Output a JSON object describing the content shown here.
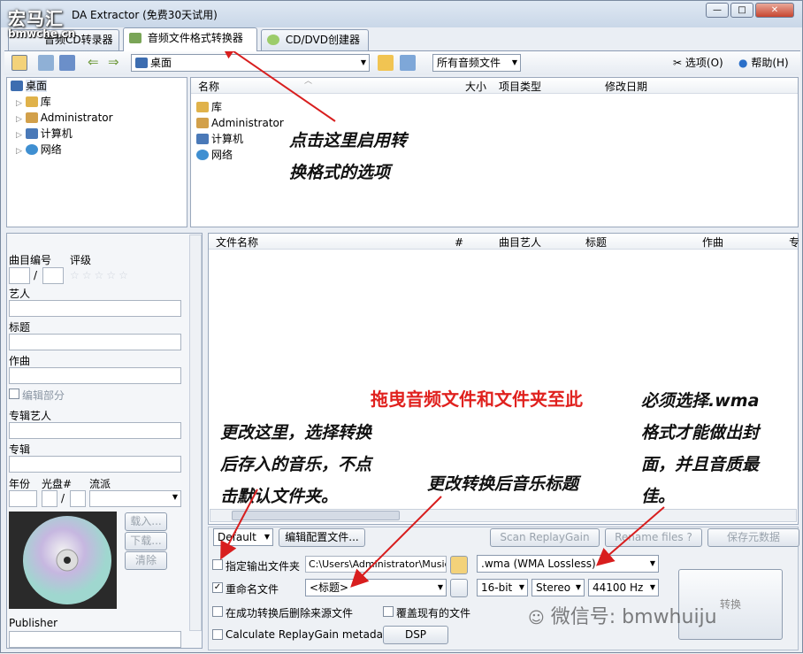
{
  "app": {
    "title": "DA Extractor (免费30天试用)",
    "brand": "宏马汇",
    "brand_sub": "bmwche.cn"
  },
  "window_controls": {
    "minimize": "—",
    "maximize": "□",
    "close": "✕"
  },
  "tabs": [
    {
      "label": "音频CD转录器"
    },
    {
      "label": "音频文件格式转换器"
    },
    {
      "label": "CD/DVD创建器"
    }
  ],
  "toolbar": {
    "location": "桌面",
    "filter": "所有音频文件",
    "options": "选项(O)",
    "help": "帮助(H)"
  },
  "tree": {
    "root": "桌面",
    "items": [
      "库",
      "Administrator",
      "计算机",
      "网络"
    ]
  },
  "browser": {
    "columns": [
      "名称",
      "大小",
      "项目类型",
      "修改日期"
    ],
    "items": [
      "库",
      "Administrator",
      "计算机",
      "网络"
    ]
  },
  "filelist": {
    "columns": [
      "文件名称",
      "#",
      "曲目艺人",
      "标题",
      "作曲",
      "专"
    ],
    "drop_hint": "拖曳音频文件和文件夹至此"
  },
  "meta": {
    "track_no": "曲目编号",
    "rating": "评级",
    "slash": "/",
    "artist": "艺人",
    "title": "标题",
    "composer": "作曲",
    "edit_part": "编辑部分",
    "album_artist": "专辑艺人",
    "album": "专辑",
    "year": "年份",
    "disc": "光盘#",
    "genre": "流派",
    "load": "载入...",
    "download": "下载...",
    "clear": "清除",
    "publisher": "Publisher"
  },
  "bottom": {
    "profile": "Default",
    "edit_profile": "编辑配置文件...",
    "scan_rg": "Scan ReplayGain",
    "rename": "Rename files ?",
    "save_meta": "保存元数据",
    "output_folder_label": "指定输出文件夹",
    "output_folder_value": "C:\\Users\\Administrator\\Music",
    "rename_label": "重命名文件",
    "rename_value": "<标题>",
    "delete_source": "在成功转换后删除来源文件",
    "overwrite": "覆盖现有的文件",
    "calc_rg": "Calculate ReplayGain metadata",
    "dsp": "DSP",
    "format": ".wma (WMA Lossless)",
    "bits": "16-bit",
    "channels": "Stereo",
    "rate": "44100 Hz",
    "convert": "转换"
  },
  "annotations": {
    "a1": "点击这里启用转换格式的选项",
    "a1_l1": "点击这里启用转",
    "a1_l2": "换格式的选项",
    "a2_l1": "更改这里，选择转换",
    "a2_l2": "后存入的音乐，不点",
    "a2_l3": "击默认文件夹。",
    "a3": "更改转换后音乐标题",
    "a4_l1": "必须选择.wma",
    "a4_l2": "格式才能做出封",
    "a4_l3": "面，并且音质最",
    "a4_l4": "佳。"
  },
  "watermark": "微信号: bmwhuiju",
  "colors": {
    "accent": "#3a6fb0",
    "annotation_red": "#e0211e",
    "arrow": "#d81e1e"
  }
}
